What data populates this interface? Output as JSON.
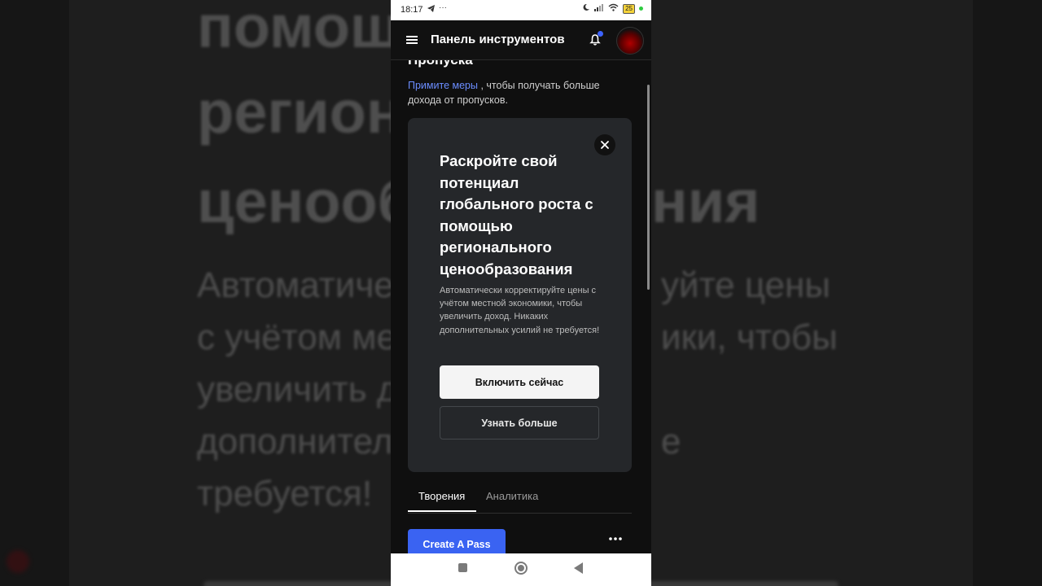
{
  "status_bar": {
    "time": "18:17",
    "more": "···",
    "battery": "25"
  },
  "app_bar": {
    "title": "Панель инструментов"
  },
  "content": {
    "section_heading": "Пропуска",
    "lead_link": "Примите меры",
    "lead_text": " , чтобы получать больше дохода от пропусков."
  },
  "promo_card": {
    "title": "Раскройте свой потенциал глобального роста с помощью регионального ценообразования",
    "description": "Автоматически корректируйте цены с учётом местной экономики, чтобы увеличить доход. Никаких дополнительных усилий не требуется!",
    "primary_button": "Включить сейчас",
    "secondary_button": "Узнать больше"
  },
  "tabs": [
    {
      "label": "Творения",
      "active": true
    },
    {
      "label": "Аналитика",
      "active": false
    }
  ],
  "actions": {
    "create_pass": "Create A Pass"
  },
  "background": {
    "heading_lines": [
      "помощ",
      "регион",
      "ценооб",
      "ния"
    ],
    "body_lines": [
      "Автоматиче",
      "уйте цены",
      "с учётом ме",
      "ики, чтобы",
      "увеличить д",
      "дополнител",
      "е",
      "требуется!"
    ]
  },
  "colors": {
    "accent_blue": "#3a63f2",
    "link_blue": "#6b8dff",
    "card_bg": "#25272a",
    "notification_dot": "#3d63ff"
  }
}
